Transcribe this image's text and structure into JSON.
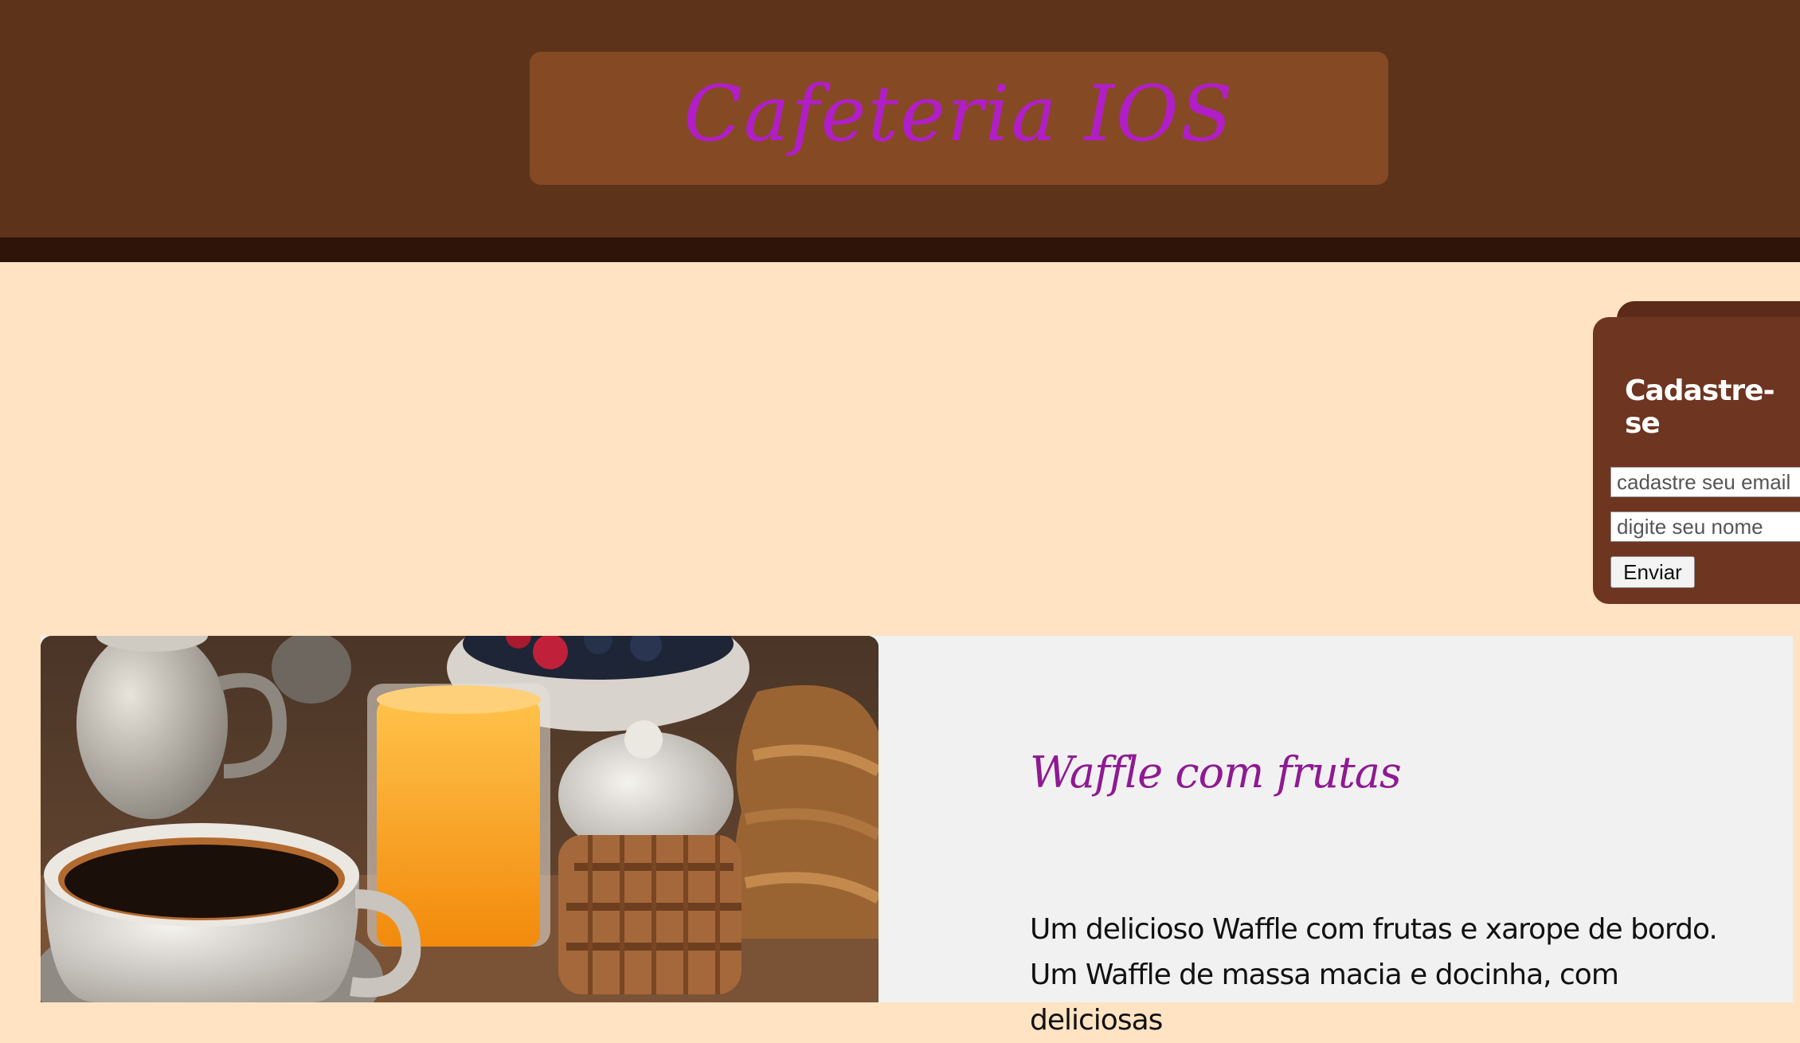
{
  "header": {
    "title": "Cafeteria IOS"
  },
  "signup": {
    "title": "Cadastre-se",
    "email_placeholder": "cadastre seu email",
    "name_placeholder": "digite seu nome",
    "submit_label": "Enviar"
  },
  "card": {
    "image_alt": "café da manhã com xícara de café, suco de laranja, açucareiro e waffles",
    "title": "Waffle com frutas",
    "description": "Um delicioso Waffle com frutas e xarope de bordo. Um Waffle de massa macia e docinha, com deliciosas"
  },
  "colors": {
    "header_bg": "#5d341a",
    "header_stripe": "#2f1509",
    "title_box": "#854a23",
    "title_text": "#b11ec8",
    "page_bg": "#ffe3c3",
    "signup_bg": "#6e3521",
    "card_bg": "#f1f1f1",
    "card_title": "#8e1a92"
  }
}
